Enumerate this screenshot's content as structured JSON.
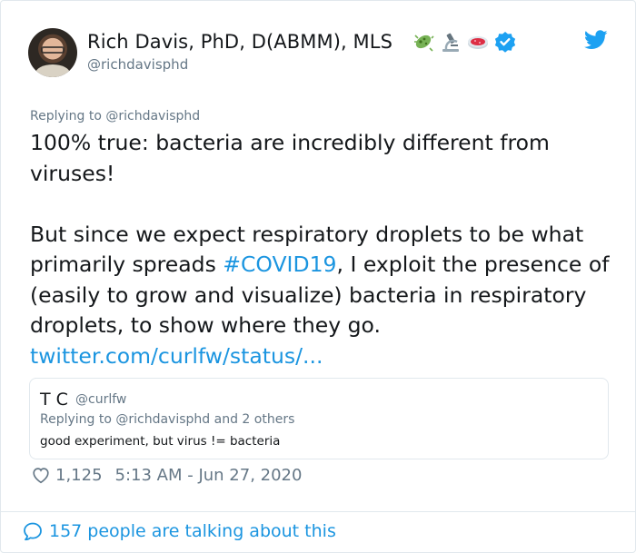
{
  "author": {
    "name": "Rich Davis, PhD, D(ABMM), MLS",
    "handle": "@richdavisphd",
    "emojis": [
      "microbe-icon",
      "microscope-icon",
      "petri-dish-icon"
    ],
    "verified": true
  },
  "tweet": {
    "replying_to": "Replying to @richdavisphd",
    "line1": "100% true: bacteria are incredibly different from viruses!",
    "line2_before": "But since we expect respiratory droplets to be what primarily spreads ",
    "hashtag": "#COVID19",
    "line2_after": ", I exploit the presence of (easily to grow and visualize) bacteria in respiratory droplets, to show where they go.",
    "link": "twitter.com/curlfw/status/..."
  },
  "quote": {
    "name": "T C",
    "handle": "@curlfw",
    "replying_to": "Replying to @richdavisphd and 2 others",
    "text": "good experiment, but virus != bacteria"
  },
  "meta": {
    "likes": "1,125",
    "timestamp": "5:13 AM - Jun 27, 2020"
  },
  "footer": {
    "talking": "157 people are talking about this"
  },
  "colors": {
    "accent": "#1b95e0",
    "muted": "#657786",
    "text": "#14171a",
    "border": "#e1e8ed"
  }
}
